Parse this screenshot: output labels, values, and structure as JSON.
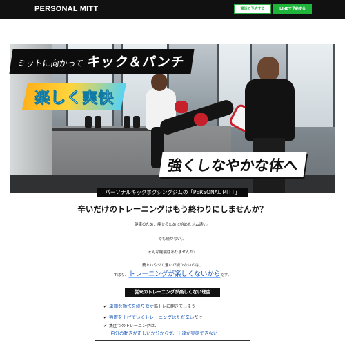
{
  "header": {
    "brand": "PERSONAL MITT",
    "phone_button": "電話で予約する",
    "line_button": "LINEで予約する",
    "colors": {
      "background": "#111111",
      "accent": "#1fb53b"
    }
  },
  "hero": {
    "tagline_small": "ミットに向かって",
    "tagline_big": "キック＆パンチ",
    "badge_fun": "楽しく爽快",
    "badge_strong": "強くしなやかな体へ",
    "caption": "パーソナルキックボクシングジムの「PERSONAL MITT」"
  },
  "intro": {
    "heading": "辛いだけのトレーニングはもう終わりにしませんか？",
    "line1": "健康のため、痩せるために始めたジム通い。",
    "line2": "でも続かない。。",
    "line3": "そんな経験はありませんか？",
    "line4": "筋トレやジム通いが続かないのは、",
    "line5_prefix": "ずばり、",
    "line5_highlight": "トレーニングが楽しくないから",
    "line5_suffix": "です。"
  },
  "problems": {
    "title": "従来のトレーニングが楽しくない理由",
    "items": [
      {
        "highlight": "単調な動作を繰り返す",
        "rest": "筋トレに飽きてしまう"
      },
      {
        "highlight": "強度を上げていくトレーニングはただ辛い",
        "rest": "だけ"
      },
      {
        "highlight": "",
        "rest": "集団でのトレーニングは、"
      }
    ],
    "item3_line2": "自分の動きが正しいか分からず、上達が実感できない"
  }
}
